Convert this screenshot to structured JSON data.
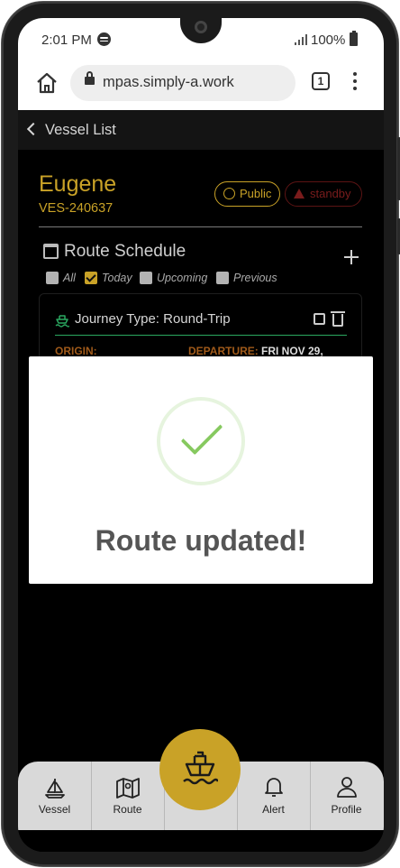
{
  "status_bar": {
    "time": "2:01 PM",
    "battery": "100%"
  },
  "browser": {
    "url": "mpas.simply-a.work",
    "tab_count": "1"
  },
  "app_header": {
    "back_label": "Vessel List"
  },
  "vessel": {
    "name": "Eugene",
    "id": "VES-240637",
    "visibility_badge": "Public",
    "status_badge": "standby"
  },
  "route_schedule": {
    "title": "Route Schedule",
    "filters": [
      {
        "label": "All",
        "checked": false
      },
      {
        "label": "Today",
        "checked": true
      },
      {
        "label": "Upcoming",
        "checked": false
      },
      {
        "label": "Previous",
        "checked": false
      }
    ],
    "card": {
      "journey_type": "Journey Type: Round-Trip",
      "origin_label": "ORIGIN:",
      "departure_label": "DEPARTURE:",
      "departure_value": "FRI NOV 29,"
    }
  },
  "modal": {
    "title": "Route updated!"
  },
  "bottom_nav": {
    "items": [
      {
        "label": "Vessel",
        "icon": "sailboat-icon"
      },
      {
        "label": "Route",
        "icon": "map-icon"
      },
      {
        "label": "",
        "icon": "ship-icon"
      },
      {
        "label": "Alert",
        "icon": "bell-icon"
      },
      {
        "label": "Profile",
        "icon": "user-icon"
      }
    ]
  },
  "colors": {
    "accent": "#c9a227",
    "standby": "#7a1c1c",
    "success": "#86c95f",
    "route_line": "#2aa860"
  }
}
